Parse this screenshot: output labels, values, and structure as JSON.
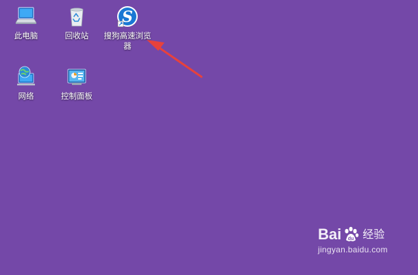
{
  "desktop": {
    "background_color": "#7448a8",
    "icons": [
      {
        "label": "此电脑",
        "icon": "computer-icon"
      },
      {
        "label": "回收站",
        "icon": "recycle-bin-icon"
      },
      {
        "label": "搜狗高速浏览器",
        "icon": "sogou-browser-icon"
      },
      {
        "label": "网络",
        "icon": "network-globe-icon"
      },
      {
        "label": "控制面板",
        "icon": "control-panel-icon"
      }
    ]
  },
  "annotation": {
    "arrow_color": "#e8413c",
    "points_to": "搜狗高速浏览器"
  },
  "watermark": {
    "brand_prefix": "Bai",
    "brand_suffix": "经验",
    "site": "jingyan.baidu.com"
  }
}
